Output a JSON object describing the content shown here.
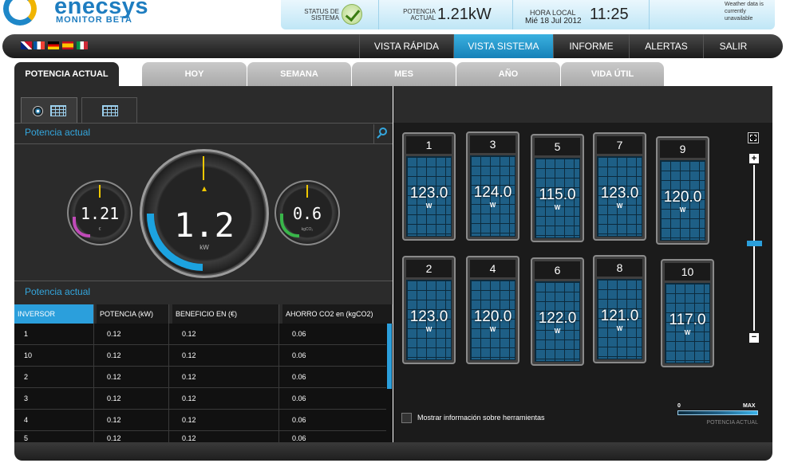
{
  "brand": {
    "name": "enecsys",
    "subtitle": "MONITOR BETA"
  },
  "status": {
    "status_label": "STATUS DE SISTEMA",
    "power_label": "POTENCIA ACTUAL",
    "power_value": "1.21kW",
    "time_label": "HORA LOCAL",
    "date": "Mié 18 Jul 2012",
    "time": "11:25",
    "weather": "Weather data is currently unavailable"
  },
  "nav": {
    "items": [
      "VISTA RÁPIDA",
      "VISTA SISTEMA",
      "INFORME",
      "ALERTAS",
      "SALIR"
    ],
    "active": "VISTA SISTEMA"
  },
  "tabs": [
    "POTENCIA ACTUAL",
    "HOY",
    "SEMANA",
    "MES",
    "AÑO",
    "VIDA ÚTIL"
  ],
  "gauges": {
    "section_title": "Potencia actual",
    "left_value": "1.21",
    "left_unit": "€",
    "main_value": "1.2",
    "main_unit": "kW",
    "right_value": "0.6",
    "right_unit": "kgCO₂"
  },
  "table": {
    "section_title": "Potencia actual",
    "headers": [
      "INVERSOR",
      "POTENCIA (kW)",
      "BENEFICIO EN (€)",
      "AHORRO CO2 en (kgCO2)"
    ],
    "rows": [
      [
        "1",
        "0.12",
        "0.12",
        "0.06"
      ],
      [
        "10",
        "0.12",
        "0.12",
        "0.06"
      ],
      [
        "2",
        "0.12",
        "0.12",
        "0.06"
      ],
      [
        "3",
        "0.12",
        "0.12",
        "0.06"
      ],
      [
        "4",
        "0.12",
        "0.12",
        "0.06"
      ],
      [
        "5",
        "0.12",
        "0.12",
        "0.06"
      ]
    ]
  },
  "panels": [
    {
      "num": "1",
      "value": "123.0",
      "unit": "W"
    },
    {
      "num": "3",
      "value": "124.0",
      "unit": "W"
    },
    {
      "num": "5",
      "value": "115.0",
      "unit": "W"
    },
    {
      "num": "7",
      "value": "123.0",
      "unit": "W"
    },
    {
      "num": "9",
      "value": "120.0",
      "unit": "W"
    },
    {
      "num": "2",
      "value": "123.0",
      "unit": "W"
    },
    {
      "num": "4",
      "value": "120.0",
      "unit": "W"
    },
    {
      "num": "6",
      "value": "122.0",
      "unit": "W"
    },
    {
      "num": "8",
      "value": "121.0",
      "unit": "W"
    },
    {
      "num": "10",
      "value": "117.0",
      "unit": "W"
    }
  ],
  "tooltip_checkbox": "Mostrar información sobre herramientas",
  "legend": {
    "min": "0",
    "max": "MAX",
    "caption": "POTENCIA ACTUAL"
  },
  "colors": {
    "accent": "#34a6dd",
    "panel_blue": "#1e5f86",
    "euro": "#c04ab8",
    "co2": "#39b54a"
  }
}
